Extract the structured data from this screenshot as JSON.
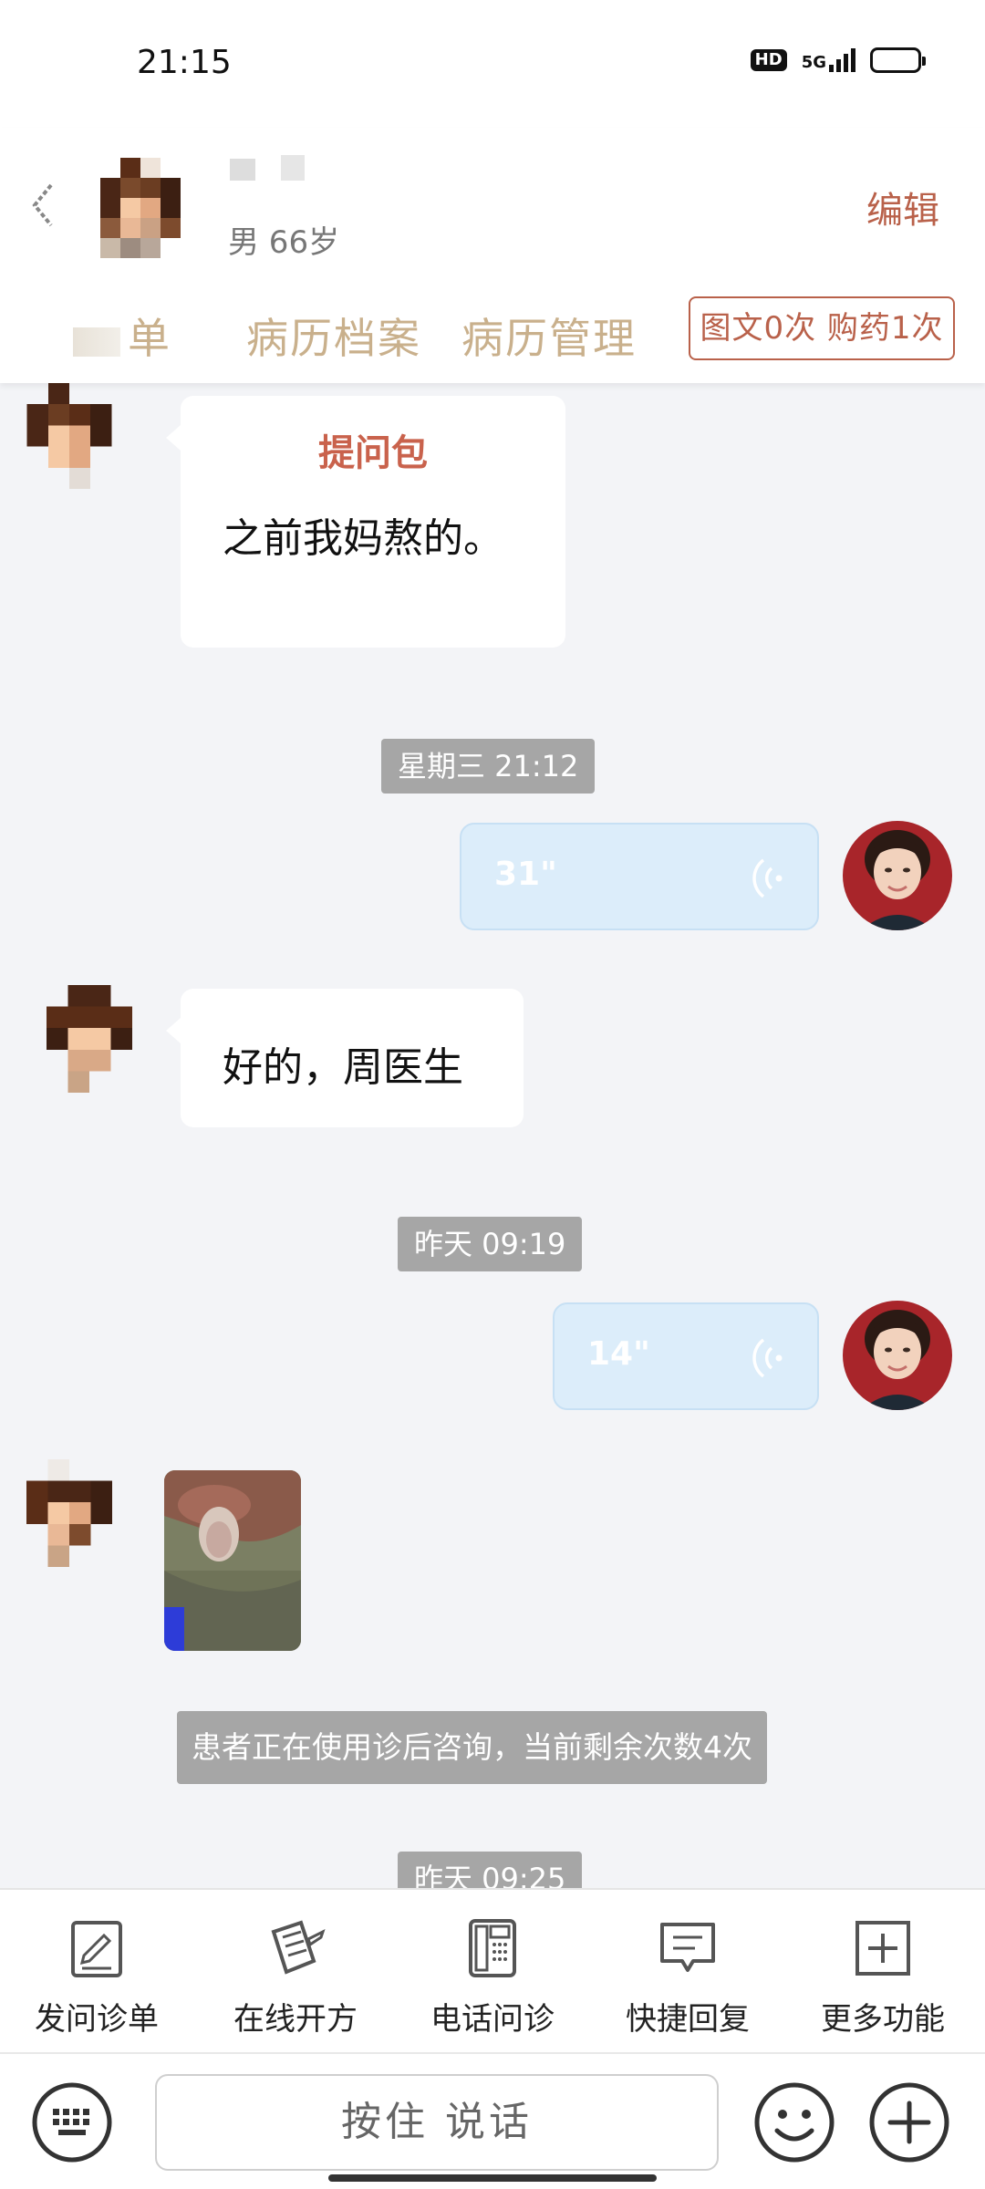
{
  "status_bar": {
    "time": "21:15",
    "hd_label": "HD",
    "network_label": "5G"
  },
  "header": {
    "patient_meta": "男 66岁",
    "edit_label": "编辑",
    "tabs": {
      "partial_tab": "单",
      "records": "病历档案",
      "management": "病历管理"
    },
    "quota_badge": "图文0次 购药1次"
  },
  "chat": {
    "messages": [
      {
        "sender": "patient",
        "type": "package",
        "title": "提问包",
        "text": "之前我妈熬的。"
      },
      {
        "type": "timestamp",
        "text": "星期三 21:12"
      },
      {
        "sender": "doctor",
        "type": "voice",
        "duration": "31\""
      },
      {
        "sender": "patient",
        "type": "text",
        "text": "好的，周医生"
      },
      {
        "type": "timestamp",
        "text": "昨天 09:19"
      },
      {
        "sender": "doctor",
        "type": "voice",
        "duration": "14\""
      },
      {
        "sender": "patient",
        "type": "image"
      },
      {
        "type": "notice",
        "text": "患者正在使用诊后咨询，当前剩余次数4次"
      },
      {
        "type": "timestamp",
        "text": "昨天 09:25"
      }
    ]
  },
  "toolbar": {
    "items": [
      {
        "label": "发问诊单",
        "icon": "questionnaire-icon"
      },
      {
        "label": "在线开方",
        "icon": "prescription-icon"
      },
      {
        "label": "电话问诊",
        "icon": "phone-icon"
      },
      {
        "label": "快捷回复",
        "icon": "quick-reply-icon"
      },
      {
        "label": "更多功能",
        "icon": "more-icon"
      }
    ]
  },
  "input_bar": {
    "hold_to_talk": "按住 说话"
  },
  "colors": {
    "accent": "#b9614a",
    "tab_text": "#c9b08c",
    "voice_bubble": "#dcedfa",
    "system_bg": "#a6a6a6",
    "chat_bg": "#f3f4f7"
  }
}
